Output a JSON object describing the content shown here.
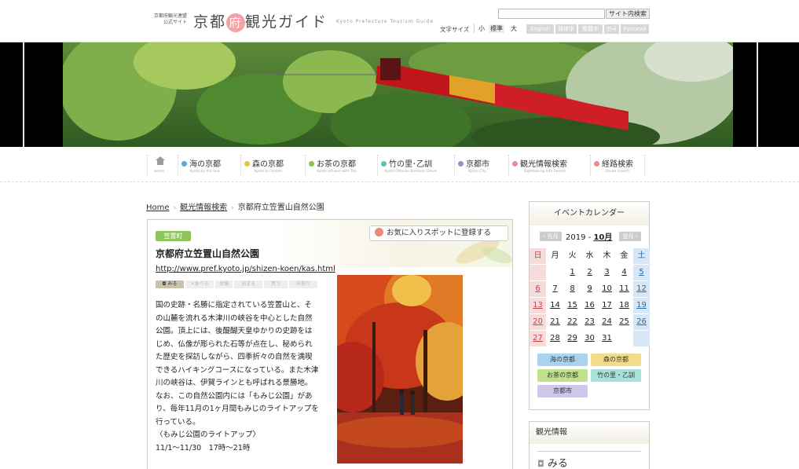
{
  "header": {
    "logo_small": [
      "京都府観光連盟",
      "公式サイト"
    ],
    "logo_pre": "京都",
    "logo_mid": "府",
    "logo_post": "観光ガイド",
    "logo_en": "Kyoto Prefecture Tourism Guide",
    "search_button": "サイト内検索",
    "font_size_label": "文字サイズ",
    "font_sizes": [
      "小",
      "標準",
      "大"
    ],
    "languages": [
      "English",
      "简体字",
      "繁體字",
      "한국",
      "Русский"
    ]
  },
  "nav": [
    {
      "title": "Home",
      "sub": "Home",
      "color": "#999999"
    },
    {
      "title": "海の京都",
      "sub": "Kyoto by the Sea",
      "color": "#5aa9d6"
    },
    {
      "title": "森の京都",
      "sub": "Kyoto In Forests",
      "color": "#e9c43a"
    },
    {
      "title": "お茶の京都",
      "sub": "Kyoto Infused with Tea",
      "color": "#8cc63e"
    },
    {
      "title": "竹の里･乙訓",
      "sub": "Kyoto Otokuni Bamboo Grove",
      "color": "#5cc2b8"
    },
    {
      "title": "京都市",
      "sub": "Kyoto City",
      "color": "#9a8ccc"
    },
    {
      "title": "観光情報検索",
      "sub": "Sightseeing Info Search",
      "color": "#ef8a8a"
    },
    {
      "title": "経路検索",
      "sub": "Route search",
      "color": "#ef8a8a"
    }
  ],
  "breadcrumb": [
    "Home",
    "観光情報検索",
    "京都府立笠置山自然公園"
  ],
  "spot": {
    "area_tag": "笠置町",
    "favorite_button": "お気に入りスポットに登録する",
    "title": "京都府立笠置山自然公園",
    "url": "http://www.pref.kyoto.jp/shizen-koen/kas.html",
    "categories": [
      "みる",
      "食べる",
      "体験",
      "泊まる",
      "買う",
      "お祭り"
    ],
    "description_lines": [
      "国の史跡・名勝に指定されている笠置山と、そ",
      "の山麓を流れる木津川の峡谷を中心とした自然",
      "公園。頂上には、後醍醐天皇ゆかりの史跡をは",
      "じめ、仏像が彫られた石等が点在し、秘められ",
      "た歴史を探訪しながら、四季折々の自然を満喫",
      "できるハイキングコースになっている。また木津",
      "川の峡谷は、伊賀ラインとも呼ばれる景勝地。",
      "なお、この自然公園内には「もみじ公園」があ",
      "り、毎年11月の1ヶ月間もみじのライトアップを",
      "行っている。",
      "〈もみじ公園のライトアップ〉",
      "11/1〜11/30　17時〜21時"
    ]
  },
  "calendar": {
    "title": "イベントカレンダー",
    "prev": "先月",
    "next": "翌月",
    "year_label": "2019 -",
    "month_label": "10月",
    "weekdays": [
      "日",
      "月",
      "火",
      "水",
      "木",
      "金",
      "土"
    ],
    "weeks": [
      [
        "",
        "",
        "1",
        "2",
        "3",
        "4",
        "5"
      ],
      [
        "6",
        "7",
        "8",
        "9",
        "10",
        "11",
        "12"
      ],
      [
        "13",
        "14",
        "15",
        "16",
        "17",
        "18",
        "19"
      ],
      [
        "20",
        "21",
        "22",
        "23",
        "24",
        "25",
        "26"
      ],
      [
        "27",
        "28",
        "29",
        "30",
        "31",
        "",
        ""
      ]
    ],
    "areas": [
      {
        "label": "海の京都",
        "bg": "#a9d3f0"
      },
      {
        "label": "森の京都",
        "bg": "#f2dc8a"
      },
      {
        "label": "お茶の京都",
        "bg": "#bfe08d"
      },
      {
        "label": "竹の里・乙訓",
        "bg": "#a8e0da"
      },
      {
        "label": "京都市",
        "bg": "#cfc6ec"
      }
    ]
  },
  "kanko": {
    "title": "観光情報",
    "first_item": "みる"
  }
}
